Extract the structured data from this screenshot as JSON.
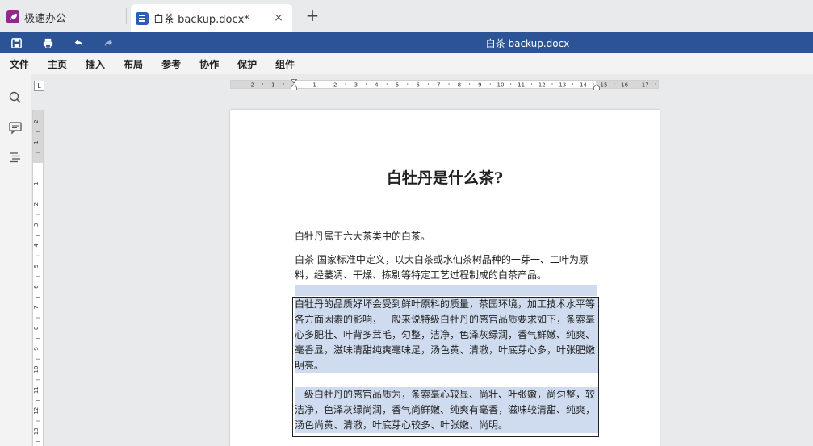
{
  "app": {
    "name": "极速办公"
  },
  "tab": {
    "title": "白茶 backup.docx*",
    "close": "×",
    "new": "+"
  },
  "titlebar": {
    "doc_title": "白茶 backup.docx"
  },
  "menu": [
    "文件",
    "主页",
    "插入",
    "布局",
    "参考",
    "协作",
    "保护",
    "组件"
  ],
  "ruler": {
    "corner": "L",
    "h_numbers": [
      "2",
      "1",
      "1",
      "2",
      "3",
      "4",
      "5",
      "6",
      "7",
      "8",
      "9",
      "10",
      "11",
      "12",
      "13",
      "14",
      "15",
      "16",
      "17"
    ],
    "v_numbers": [
      "2",
      "1",
      "1",
      "2",
      "3",
      "4",
      "5",
      "6",
      "7",
      "8",
      "9",
      "10",
      "11",
      "12",
      "13"
    ]
  },
  "document": {
    "heading": "白牡丹是什么茶?",
    "p1": "白牡丹属于六大茶类中的白茶。",
    "p2": "白茶  国家标准中定义，以大白茶或水仙茶树品种的一芽一、二叶为原料，经萎凋、干燥、拣剔等特定工艺过程制成的白茶产品。",
    "p3": "白牡丹的品质好坏会受到鲜叶原料的质量，茶园环境，加工技术水平等各方面因素的影响，一般来说特级白牡丹的感官品质要求如下，条索毫心多肥壮、叶背多茸毛，匀整，洁净，色泽灰绿润，香气鲜嫩、纯爽、 毫香显，滋味清甜纯爽毫味足，汤色黄、清澈，叶底芽心多，叶张肥嫩明亮。",
    "p4": "一级白牡丹的感官品质为，条索毫心较显、尚壮、叶张嫩，尚匀整，较洁净，色泽灰绿尚润，香气尚鲜嫩、纯爽有毫香，滋味较清甜、纯爽，汤色尚黄、清澈，叶底芽心较多、叶张嫩、尚明。"
  },
  "colors": {
    "brand_bar": "#2b5396",
    "selection": "#cfdcef",
    "app_logo": "#8e2a8e",
    "doc_icon": "#2b5eb8"
  }
}
